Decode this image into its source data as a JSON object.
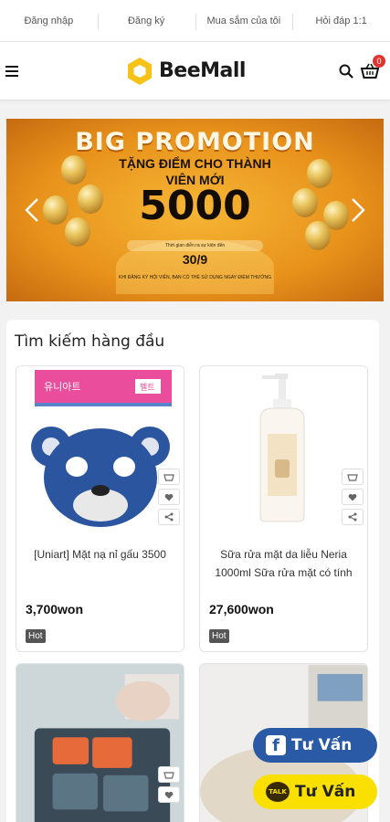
{
  "top_links": [
    "Đăng nhập",
    "Đăng ký",
    "Mua sắm của tôi",
    "Hỏi đáp 1:1"
  ],
  "header": {
    "logo_text": "BeeMall",
    "cart_count": "0"
  },
  "icons": {
    "menu": "hamburger-icon",
    "search": "search-icon",
    "cart": "cart-icon"
  },
  "banner": {
    "title": "BIG PROMOTION",
    "subtitle_line1": "TẶNG ĐIỂM CHO THÀNH",
    "subtitle_line2": "VIÊN MỚI",
    "amount": "5000",
    "note": "Thời gian diễn ra sự kiện đến",
    "date": "30/9",
    "footer": "KHI ĐĂNG KÝ HỘI VIÊN, BẠN CÓ THỂ SỬ DỤNG NGAY ĐIỂM THƯỞNG"
  },
  "section": {
    "title": "Tìm kiếm hàng đầu",
    "products": [
      {
        "name": "[Uniart] Mặt nạ nỉ gấu 3500",
        "price": "3,700won",
        "badge": "Hot"
      },
      {
        "name": "Sữa rửa mặt da liễu Neria 1000ml Sữa rửa mặt có tính",
        "price": "27,600won",
        "badge": "Hot"
      },
      {
        "name": "",
        "price": "",
        "badge": ""
      },
      {
        "name": "",
        "price": "",
        "badge": ""
      }
    ]
  },
  "floating": {
    "facebook_label": "Tư Vấn",
    "talk_label": "Tư Vấn",
    "talk_logo": "TALK"
  },
  "colors": {
    "accent": "#e0342f",
    "facebook": "#2a5aa6",
    "talk": "#f9e000",
    "banner": "#e8921b"
  }
}
